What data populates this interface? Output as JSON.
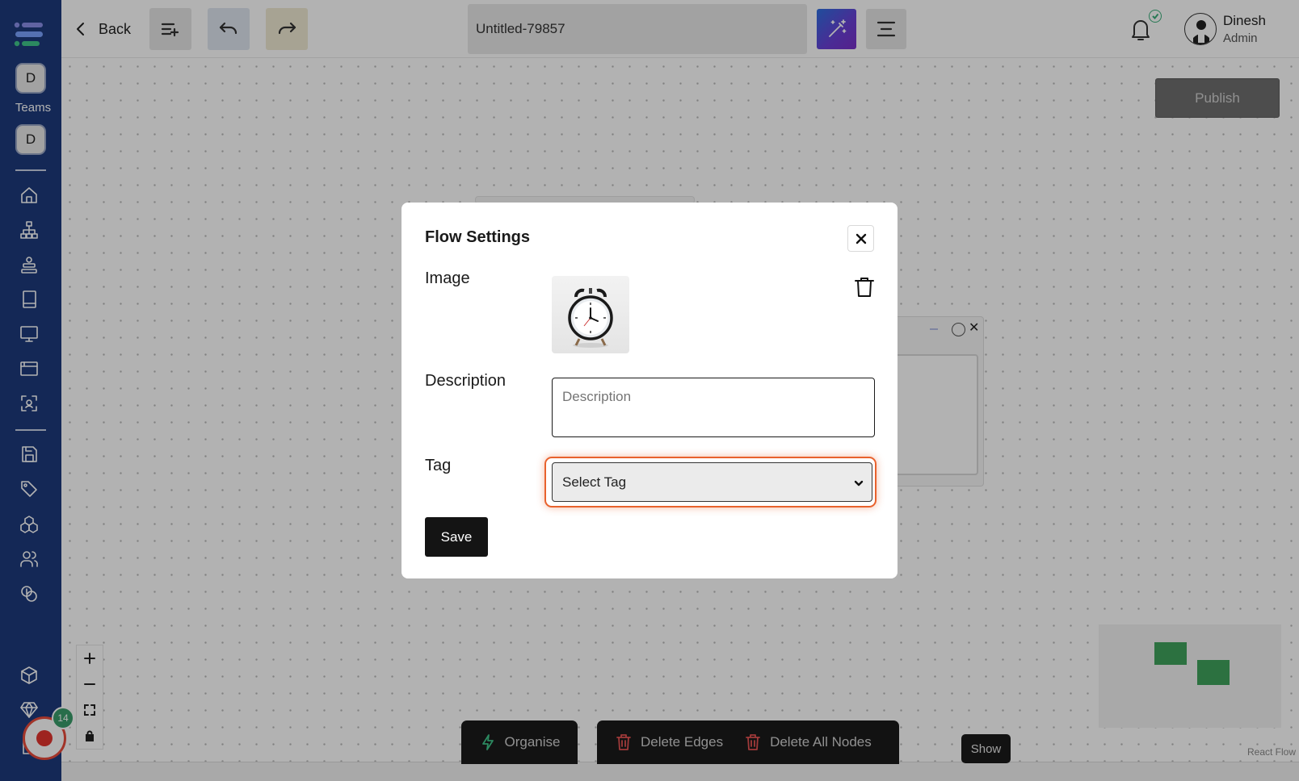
{
  "sidebar": {
    "teams": [
      {
        "initial": "D"
      },
      {
        "initial": "D"
      }
    ],
    "teams_label": "Teams",
    "nav_icons": [
      "home-icon",
      "hierarchy-icon",
      "stack-icon",
      "book-icon",
      "monitor-icon",
      "browser-icon",
      "scan-icon",
      "save-icon",
      "tag-icon",
      "cubes-icon",
      "users-icon",
      "coins-icon",
      "package-icon",
      "diamond-icon",
      "document-icon"
    ]
  },
  "header": {
    "back_label": "Back",
    "flow_title": "Untitled-79857",
    "user": {
      "name": "Dinesh",
      "role": "Admin"
    }
  },
  "canvas": {
    "publish_label": "Publish",
    "minimap_label": "React Flow"
  },
  "modal": {
    "title": "Flow Settings",
    "image_label": "Image",
    "description_label": "Description",
    "description_placeholder": "Description",
    "tag_label": "Tag",
    "tag_selected": "Select Tag",
    "save_label": "Save"
  },
  "toolbar": {
    "organise_label": "Organise",
    "delete_edges_label": "Delete Edges",
    "delete_nodes_label": "Delete All Nodes",
    "show_label": "Show"
  },
  "recorder": {
    "badge_count": "14"
  },
  "colors": {
    "sidebar_bg": "#1e3a7b",
    "focus_ring": "#e8622d",
    "minimap_node": "#3fa35c",
    "badge": "#3a9c6a"
  }
}
